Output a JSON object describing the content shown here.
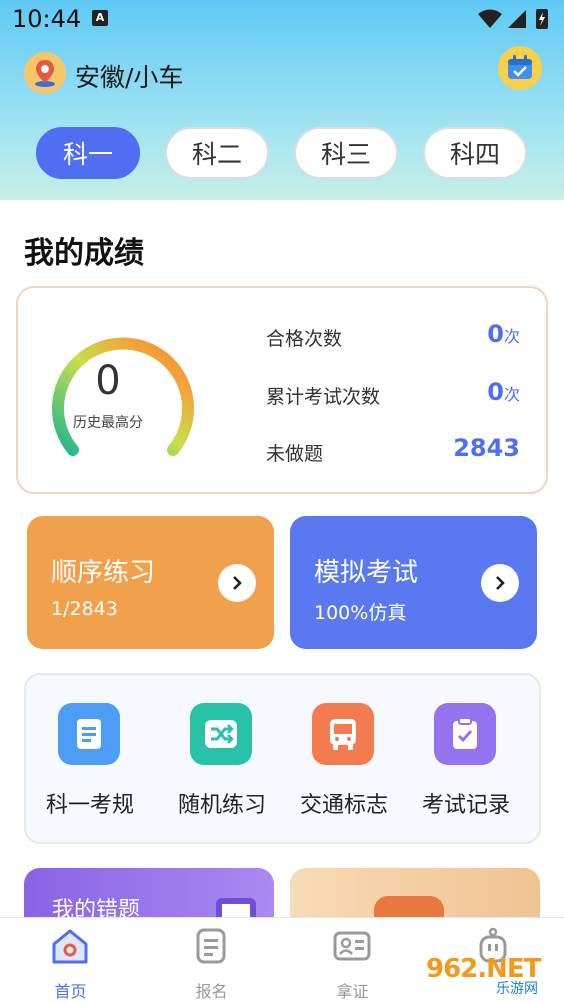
{
  "status": {
    "time": "10:44",
    "a_badge": "A"
  },
  "header": {
    "location": "安徽/小车",
    "location_icon": "map-pin-icon",
    "calendar_icon": "calendar-check-icon"
  },
  "tabs": [
    {
      "label": "科一",
      "active": true
    },
    {
      "label": "科二",
      "active": false
    },
    {
      "label": "科三",
      "active": false
    },
    {
      "label": "科四",
      "active": false
    }
  ],
  "scores": {
    "title": "我的成绩",
    "best_score": "0",
    "best_label": "历史最高分",
    "stats": [
      {
        "label": "合格次数",
        "value": "0",
        "unit": "次"
      },
      {
        "label": "累计考试次数",
        "value": "0",
        "unit": "次"
      },
      {
        "label": "未做题",
        "value": "2843",
        "unit": ""
      }
    ]
  },
  "actions": [
    {
      "title": "顺序练习",
      "sub": "1/2843",
      "color": "#f1a04c"
    },
    {
      "title": "模拟考试",
      "sub": "100%仿真",
      "color": "#5a78f0"
    }
  ],
  "tools": [
    {
      "label": "科一考规",
      "icon": "document-icon",
      "color": "#4e9df5"
    },
    {
      "label": "随机练习",
      "icon": "shuffle-icon",
      "color": "#27c2a8"
    },
    {
      "label": "交通标志",
      "icon": "bus-icon",
      "color": "#f47b4f"
    },
    {
      "label": "考试记录",
      "icon": "clipboard-check-icon",
      "color": "#9474ee"
    }
  ],
  "promos": [
    {
      "title": "我的错题"
    },
    {
      "title": ""
    }
  ],
  "nav": [
    {
      "label": "首页",
      "icon": "home-icon",
      "active": true
    },
    {
      "label": "报名",
      "icon": "form-icon",
      "active": false
    },
    {
      "label": "拿证",
      "icon": "id-card-icon",
      "active": false
    },
    {
      "label": "",
      "icon": "robot-icon",
      "active": false
    }
  ],
  "watermark": {
    "logo": "962.NET",
    "sub": "乐游网"
  },
  "colors": {
    "accent": "#4f6ef2",
    "orange": "#f1a04c",
    "card_border": "#f2d3bd"
  }
}
